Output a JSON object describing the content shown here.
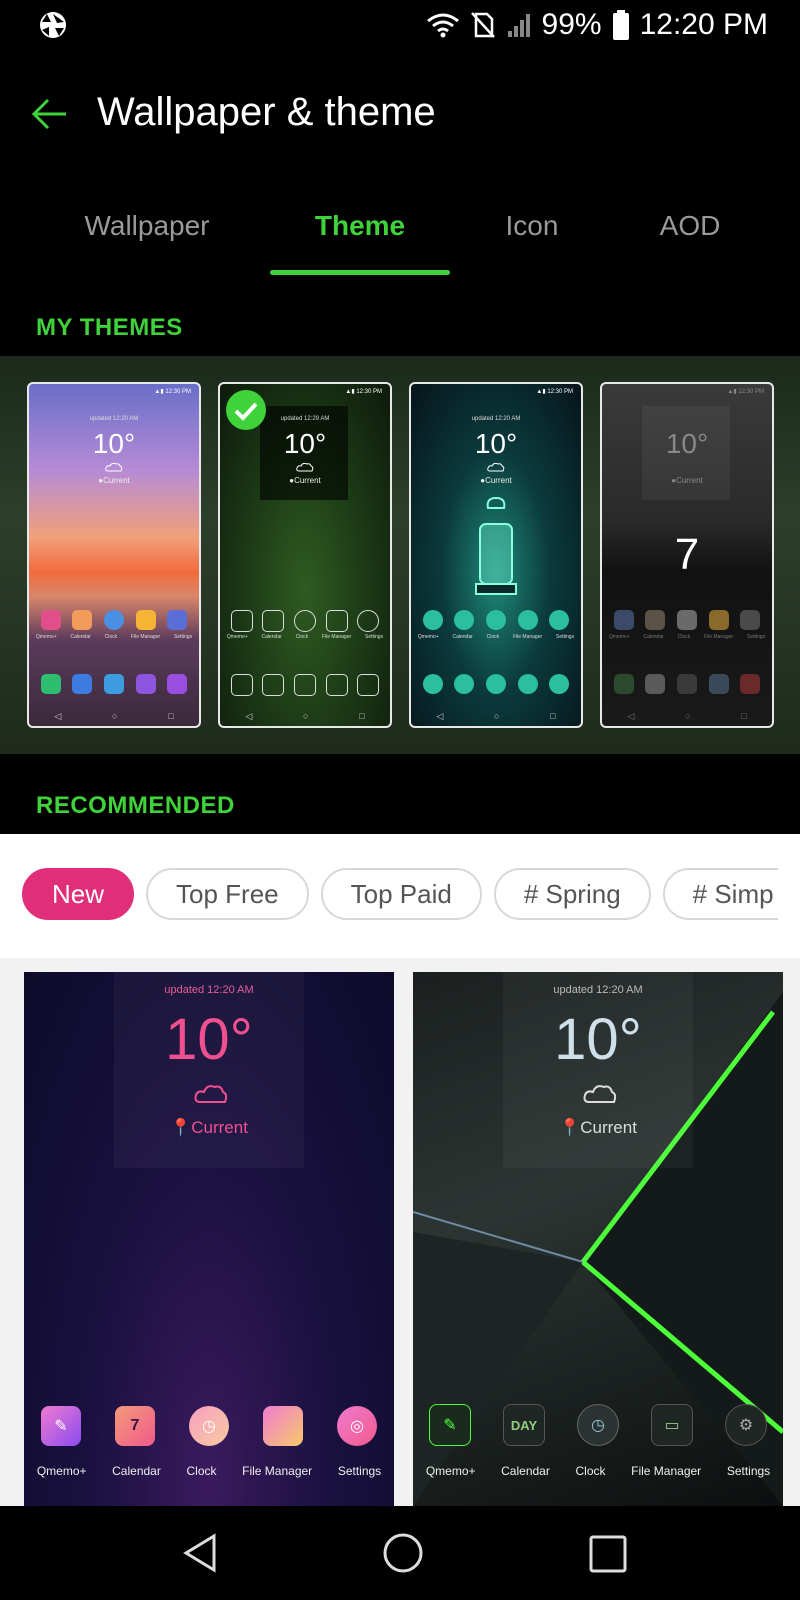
{
  "status": {
    "battery": "99%",
    "time": "12:20 PM",
    "icons": [
      "aperture-icon",
      "wifi-icon",
      "no-sim-icon",
      "signal-icon",
      "battery-icon"
    ]
  },
  "header": {
    "title": "Wallpaper & theme",
    "back_icon": "back-arrow-icon"
  },
  "tabs": [
    {
      "label": "Wallpaper",
      "active": false
    },
    {
      "label": "Theme",
      "active": true
    },
    {
      "label": "Icon",
      "active": false
    },
    {
      "label": "AOD",
      "active": false
    }
  ],
  "my_themes": {
    "label": "MY THEMES",
    "thumbs": [
      {
        "temp": "10°",
        "selected": false
      },
      {
        "temp": "10°",
        "selected": true
      },
      {
        "temp": "10°",
        "selected": false
      },
      {
        "temp": "10°",
        "big_number": "7",
        "selected": false
      }
    ]
  },
  "recommended": {
    "label": "RECOMMENDED",
    "chips": [
      {
        "label": "New",
        "active": true
      },
      {
        "label": "Top Free",
        "active": false
      },
      {
        "label": "Top Paid",
        "active": false
      },
      {
        "label": "# Spring",
        "active": false
      },
      {
        "label": "# Simp",
        "active": false
      }
    ],
    "cards": [
      {
        "updated": "updated 12:20 AM",
        "temp": "10°",
        "location": "Current",
        "apps": [
          "Qmemo+",
          "Calendar",
          "Clock",
          "File Manager",
          "Settings"
        ],
        "calendar_icon_text": "7"
      },
      {
        "updated": "updated 12:20 AM",
        "temp": "10°",
        "location": "Current",
        "apps": [
          "Qmemo+",
          "Calendar",
          "Clock",
          "File Manager",
          "Settings"
        ],
        "calendar_icon_text": "DAY"
      }
    ]
  },
  "colors": {
    "accent_green": "#3fd23a",
    "chip_pink": "#e02f78"
  },
  "navbar": {
    "icons": [
      "back-triangle-icon",
      "home-circle-icon",
      "recents-square-icon"
    ]
  }
}
